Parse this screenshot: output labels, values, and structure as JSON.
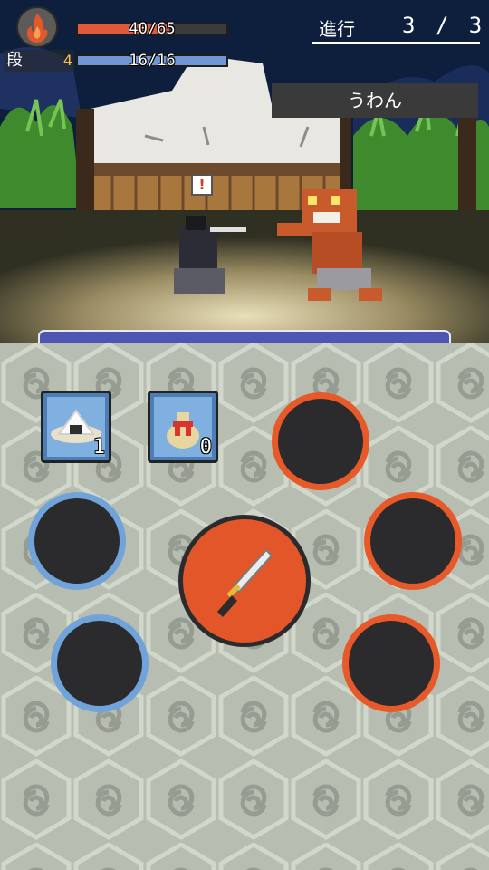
{
  "hud": {
    "rank_label": "段",
    "rank_value": "4",
    "hp_text": "40/65",
    "hp_fraction": 0.615,
    "mp_text": "16/16",
    "mp_fraction": 1.0,
    "progress_label": "進行",
    "progress_value": "3 / 3"
  },
  "enemy": {
    "name": "うわん"
  },
  "items": [
    {
      "name": "onigiri",
      "count": "1"
    },
    {
      "name": "bag",
      "count": "0"
    }
  ],
  "colors": {
    "hp": "#e05a3a",
    "mp": "#6f96d6",
    "action_bar": "#4d56b3",
    "accent_orange": "#e8592a",
    "accent_blue": "#6fa3da"
  }
}
